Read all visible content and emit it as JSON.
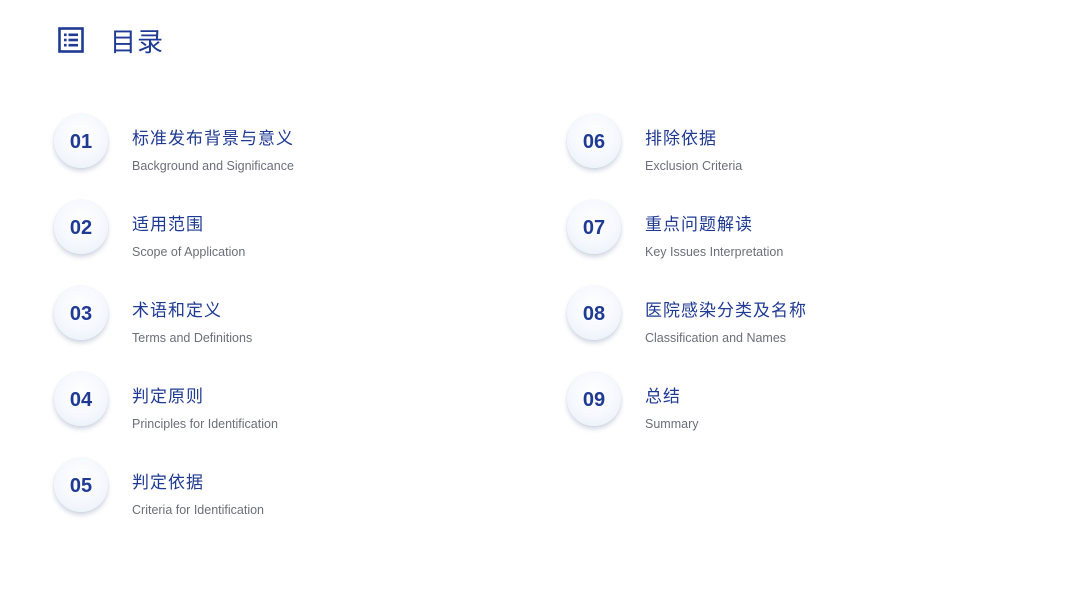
{
  "header": {
    "icon": "list-icon",
    "title": "目录"
  },
  "colors": {
    "accent": "#1f3a93",
    "subtitle": "#6b6f7a",
    "background": "#ffffff"
  },
  "toc": {
    "items": [
      {
        "num": "01",
        "zh": "标准发布背景与意义",
        "en": "Background and Significance"
      },
      {
        "num": "02",
        "zh": "适用范围",
        "en": "Scope of Application"
      },
      {
        "num": "03",
        "zh": "术语和定义",
        "en": "Terms and Definitions"
      },
      {
        "num": "04",
        "zh": "判定原则",
        "en": "Principles for Identification"
      },
      {
        "num": "05",
        "zh": "判定依据",
        "en": "Criteria for Identification"
      },
      {
        "num": "06",
        "zh": "排除依据",
        "en": "Exclusion Criteria"
      },
      {
        "num": "07",
        "zh": "重点问题解读",
        "en": "Key Issues Interpretation"
      },
      {
        "num": "08",
        "zh": "医院感染分类及名称",
        "en": "Classification and Names"
      },
      {
        "num": "09",
        "zh": "总结",
        "en": "Summary"
      }
    ]
  }
}
